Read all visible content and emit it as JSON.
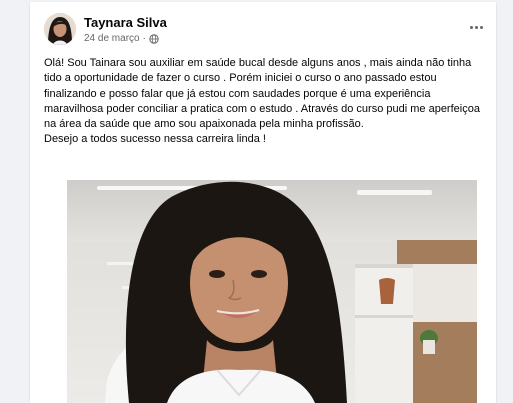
{
  "post": {
    "author": "Taynara Silva",
    "date": "24 de março",
    "separator": "·",
    "audience_icon": "globe-icon",
    "menu_icon": "more-options-icon",
    "paragraphs": [
      "Olá! Sou Tainara sou auxiliar em saúde bucal desde alguns anos , mais ainda não tinha tido a oportunidade de fazer o curso . Porém iniciei o curso o ano passado estou finalizando e posso falar que já estou com saudades  porque é uma experiência maravilhosa poder conciliar a pratica com o estudo . Através do curso pudi me aperfeiçoa na área da saúde que amo sou apaixonada pela minha profissão.",
      "Desejo a todos sucesso nessa carreira linda !"
    ]
  },
  "colors": {
    "name": "#050505",
    "meta": "#65676b",
    "background": "#f0f2f5"
  }
}
